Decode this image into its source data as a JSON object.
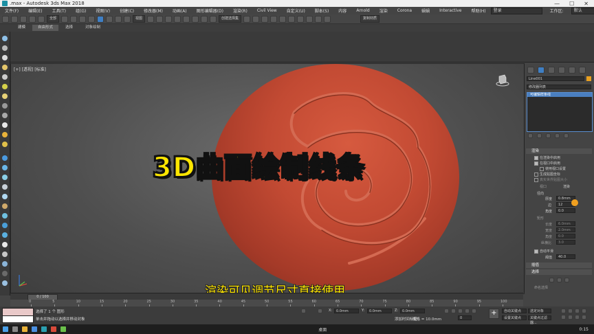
{
  "window": {
    "title": ".max - Autodesk 3ds Max 2018",
    "controls": [
      "—",
      "☐",
      "✕"
    ]
  },
  "menu": {
    "items": [
      "文件(F)",
      "编辑(E)",
      "工具(T)",
      "组(G)",
      "视图(V)",
      "创建(C)",
      "修改器(M)",
      "动画(A)",
      "图形编辑器(D)",
      "渲染(R)",
      "Civil View",
      "自定义(U)",
      "脚本(S)",
      "内容",
      "Arnold",
      "渲染",
      "Corona",
      "蝸蝸",
      "Interactive",
      "帮助(H)"
    ],
    "signin": "登录",
    "workspace_label": "工作区:",
    "workspace_value": "默认"
  },
  "toolbar": {
    "select_filter": "全部",
    "view_mode": "视图",
    "named_selection": "创建选择集",
    "copy_label": "复制材质"
  },
  "ribbon": {
    "tabs": [
      "建模",
      "自由形式",
      "选择",
      "对象绘制"
    ]
  },
  "viewport": {
    "label": "[+] [透视] [标准] [默认明暗处理]",
    "label_short": "[+] [透视] [标准]",
    "overlay_title": "3D曲面绘制线条",
    "overlay_subtitle": "渲染可见调节尺寸直接使用",
    "sphere_color": "#c24a33"
  },
  "command_panel": {
    "object_name": "Line001",
    "modifier_list": "修改器列表",
    "stack_item": "可编辑样条线",
    "rollout_render": "渲染",
    "enable_in_renderer": "在渲染中启用",
    "enable_in_viewport": "在视口中启用",
    "use_viewport_settings": "使用视口设置",
    "generate_mapping": "生成贴图坐标",
    "real_world_map": "真实世界贴图大小",
    "viewport_radio": "视口",
    "render_radio": "渲染",
    "radial": "径向",
    "thickness_label": "厚度",
    "thickness_value": "0.8mm",
    "sides_label": "边",
    "sides_value": "12",
    "angle_label": "角度",
    "angle_value": "0.0",
    "rectangular": "矩形",
    "length_label": "长度",
    "length_value": "6.0mm",
    "width_label": "宽度",
    "width_value": "2.0mm",
    "angle2_label": "角度",
    "angle2_value": "0.0",
    "aspect_label": "纵横比",
    "aspect_value": "3.0",
    "auto_smooth": "自动平滑",
    "threshold_label": "阈值",
    "threshold_value": "40.0",
    "rollout_interp": "插值",
    "rollout_select": "选择",
    "named_sel": "命名选择"
  },
  "timeline": {
    "frame_display": "0 / 100",
    "ticks": [
      "0",
      "5",
      "10",
      "15",
      "20",
      "25",
      "30",
      "35",
      "40",
      "45",
      "50",
      "55",
      "60",
      "65",
      "70",
      "75",
      "80",
      "85",
      "90",
      "95",
      "100"
    ]
  },
  "status": {
    "selection_info": "选择了 1 个 图形",
    "hint": "单击并拖动以选择并移动对象",
    "x_value": "0.0mm",
    "y_value": "0.0mm",
    "z_value": "0.0mm",
    "grid": "栅格 = 10.0mm",
    "add_time_tag": "添加时间标记",
    "auto_key": "自动关键点",
    "set_key": "设置关键点",
    "selected_obj": "选定对象",
    "key_filters": "关键点过滤器...",
    "frame": "0"
  },
  "taskbar": {
    "clock": "0:15",
    "lang": "桌面"
  }
}
